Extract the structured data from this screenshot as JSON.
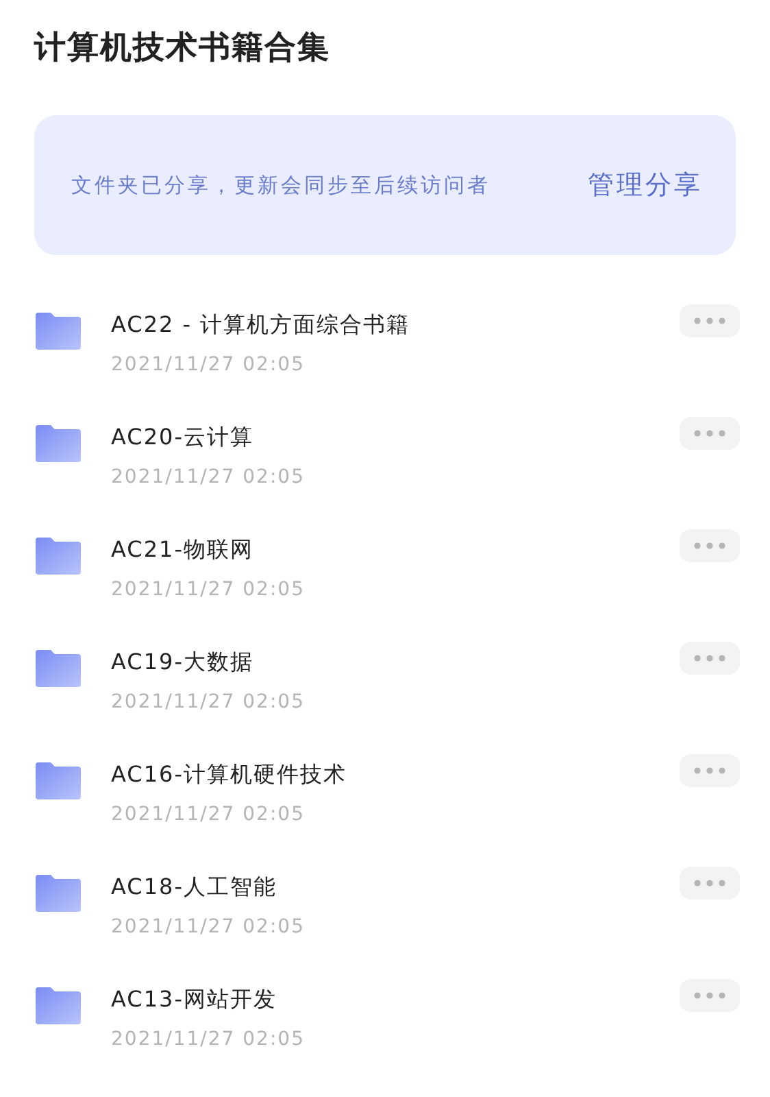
{
  "title": "计算机技术书籍合集",
  "banner": {
    "message": "文件夹已分享，更新会同步至后续访问者",
    "action": "管理分享"
  },
  "folders": [
    {
      "name": "AC22 - 计算机方面综合书籍",
      "date": "2021/11/27 02:05"
    },
    {
      "name": "AC20-云计算",
      "date": "2021/11/27 02:05"
    },
    {
      "name": "AC21-物联网",
      "date": "2021/11/27 02:05"
    },
    {
      "name": "AC19-大数据",
      "date": "2021/11/27 02:05"
    },
    {
      "name": "AC16-计算机硬件技术",
      "date": "2021/11/27 02:05"
    },
    {
      "name": "AC18-人工智能",
      "date": "2021/11/27 02:05"
    },
    {
      "name": "AC13-网站开发",
      "date": "2021/11/27 02:05"
    }
  ]
}
